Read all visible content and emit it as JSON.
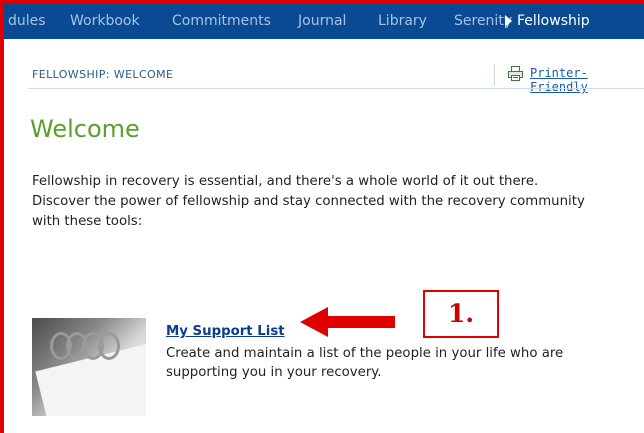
{
  "nav": {
    "items": [
      {
        "label": "dules"
      },
      {
        "label": "Workbook"
      },
      {
        "label": "Commitments"
      },
      {
        "label": "Journal"
      },
      {
        "label": "Library"
      },
      {
        "label": "Serenity"
      },
      {
        "label": "Fellowship"
      }
    ],
    "active_index": 6
  },
  "breadcrumb": "FELLOWSHIP: WELCOME",
  "printer": {
    "label": "Printer-Friendly",
    "icon": "printer-icon"
  },
  "page_title": "Welcome",
  "intro_lines": [
    "Fellowship in recovery is essential, and there's a whole world of it out there.",
    "Discover the power of fellowship and stay connected with the recovery community",
    "with these tools:"
  ],
  "support": {
    "link": "My Support List",
    "desc_lines": [
      "Create and maintain a list of the people in your life who are",
      "supporting you in your recovery."
    ],
    "thumbnail_icon": "notebook-rings-photo"
  },
  "annotation": {
    "label": "1.",
    "color": "#e00000"
  },
  "colors": {
    "nav_bg": "#0a4a92",
    "nav_text": "#a7c3e4",
    "nav_active": "#ffffff",
    "title_green": "#5aa02c",
    "link_blue": "#0a3d91",
    "annotation_red": "#e00000"
  }
}
